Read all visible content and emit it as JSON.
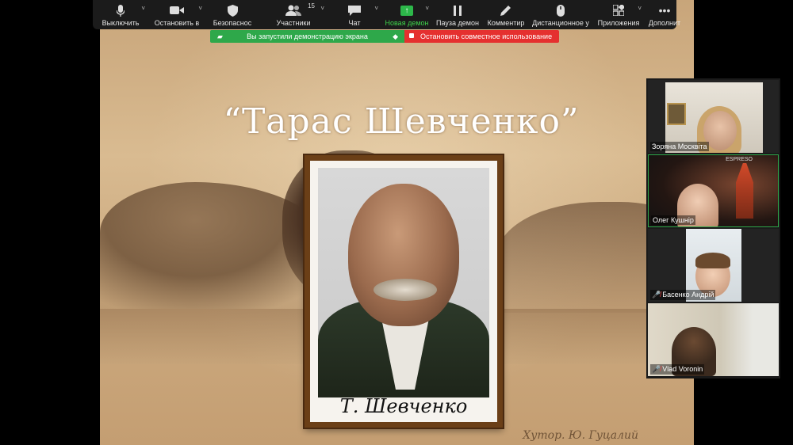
{
  "toolbar": {
    "items": [
      {
        "label": "Выключить",
        "icon": "microphone-icon",
        "caret": true
      },
      {
        "label": "Остановить в",
        "icon": "video-camera-icon",
        "caret": true
      },
      {
        "label": "Безопаснос",
        "icon": "shield-icon",
        "caret": false
      },
      {
        "label": "Участники",
        "icon": "participants-icon",
        "caret": true,
        "count": "15"
      },
      {
        "label": "Чат",
        "icon": "chat-icon",
        "caret": true
      },
      {
        "label": "Новая демон",
        "icon": "share-screen-icon",
        "caret": true,
        "active": true
      },
      {
        "label": "Пауза демон",
        "icon": "pause-icon",
        "caret": false
      },
      {
        "label": "Комментир",
        "icon": "pencil-icon",
        "caret": false
      },
      {
        "label": "Дистанционное у",
        "icon": "mouse-icon",
        "caret": false
      },
      {
        "label": "Приложения",
        "icon": "apps-icon",
        "caret": true
      },
      {
        "label": "Дополнит",
        "icon": "more-icon",
        "caret": false
      }
    ]
  },
  "banner": {
    "share_text": "Вы запустили демонстрацию экрана",
    "stop_text": "Остановить совместное использование"
  },
  "slide": {
    "title": "“Тарас Шевченко”",
    "portrait_signature": "Т. Шевченко",
    "corner_caption": "Хутор. Ю. Гуцалий"
  },
  "participants": [
    {
      "name": "Зоряна Москвіта",
      "muted": false
    },
    {
      "name": "Олег Кушнір",
      "muted": false,
      "overlay": "ESPRESO"
    },
    {
      "name": "Басенко Андрій",
      "muted": true
    },
    {
      "name": "Vlad Voronin",
      "muted": true
    }
  ],
  "colors": {
    "toolbar_bg": "#1b1b1b",
    "share_green": "#2ea84a",
    "stop_red": "#e5302f",
    "active_speaker_border": "#2ea84a"
  }
}
